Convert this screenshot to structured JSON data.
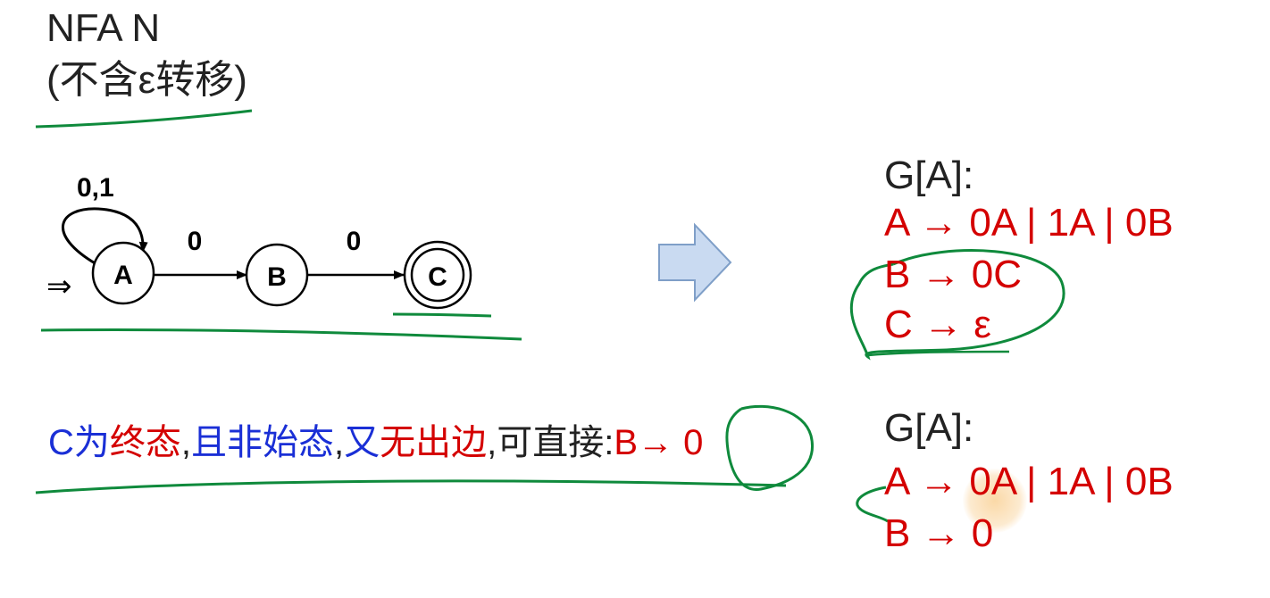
{
  "heading": {
    "line1": "NFA  N",
    "line2": "(不含ε转移)"
  },
  "nfa": {
    "start_arrow": "⇒",
    "states": [
      "A",
      "B",
      "C"
    ],
    "final_state": "C",
    "self_loop_label": "0,1",
    "edge_ab_label": "0",
    "edge_bc_label": "0"
  },
  "grammar1": {
    "title": "G[A]:",
    "productions": [
      "A → 0A | 1A | 0B",
      "B → 0C",
      "C → ε"
    ]
  },
  "note": {
    "part1": "C为",
    "part2": "终态",
    "part3": ",",
    "part4": "且非始态",
    "part5": ",",
    "part6": "又",
    "part7": "无出边",
    "part8": ",可直接:",
    "part9": "B→ 0"
  },
  "grammar2": {
    "title": "G[A]:",
    "productions": [
      "A → 0A | 1A | 0B",
      "B → 0"
    ]
  },
  "colors": {
    "production": "#d40000",
    "annotation": "#0f8a3c",
    "arrow_fill": "#c9daf1",
    "arrow_stroke": "#7f9fc8",
    "note_blue": "#1a2fd6"
  }
}
